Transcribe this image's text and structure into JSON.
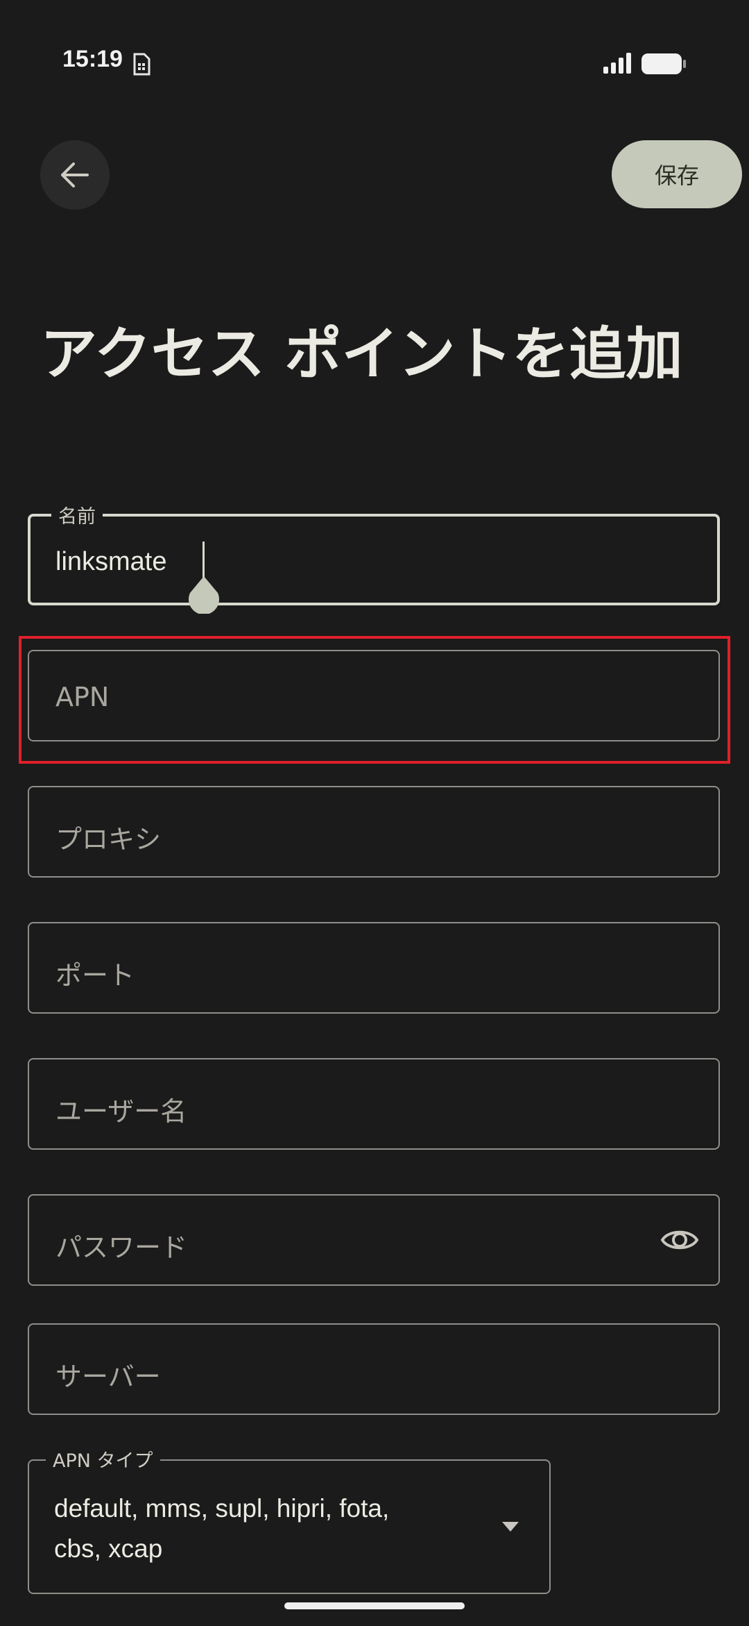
{
  "status_bar": {
    "time": "15:19"
  },
  "header": {
    "save_label": "保存"
  },
  "page": {
    "title": "アクセス ポイントを追加"
  },
  "fields": {
    "name": {
      "label": "名前",
      "value": "linksmate"
    },
    "apn": {
      "placeholder": "APN"
    },
    "proxy": {
      "placeholder": "プロキシ"
    },
    "port": {
      "placeholder": "ポート"
    },
    "username": {
      "placeholder": "ユーザー名"
    },
    "password": {
      "placeholder": "パスワード"
    },
    "server": {
      "placeholder": "サーバー"
    },
    "apn_type": {
      "label": "APN タイプ",
      "value": "default, mms, supl, hipri, fota, cbs, xcap"
    }
  },
  "icons": {
    "back": "arrow-left-icon",
    "sim": "sim-card-icon",
    "signal": "signal-icon",
    "battery": "battery-icon",
    "eye": "eye-icon",
    "dropdown": "triangle-down-icon"
  },
  "colors": {
    "background": "#1b1b1b",
    "accent_button": "#c5c9b9",
    "highlight": "#e0202a"
  }
}
